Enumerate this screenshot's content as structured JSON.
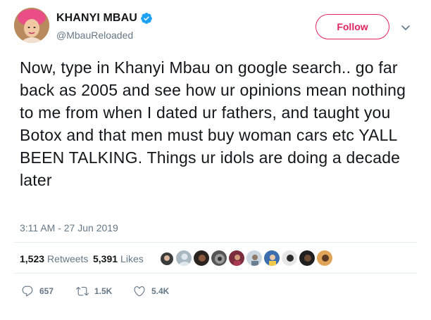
{
  "author": {
    "display_name": "KHANYI MBAU",
    "handle": "@MbauReloaded",
    "verified": true
  },
  "header": {
    "follow_label": "Follow"
  },
  "tweet": {
    "text": "Now, type in Khanyi Mbau on google search.. go far back as 2005 and see how ur opinions mean nothing to me from when I dated ur fathers, and taught you Botox and that men must buy woman cars etc YALL BEEN TALKING. Things ur idols are doing a decade later",
    "timestamp": "3:11 AM - 27 Jun 2019"
  },
  "stats": {
    "retweets_count": "1,523",
    "retweets_label": "Retweets",
    "likes_count": "5,391",
    "likes_label": "Likes"
  },
  "actions": {
    "reply_count": "657",
    "retweet_count": "1.5K",
    "like_count": "5.4K"
  },
  "colors": {
    "follow_accent": "#e0245e",
    "verified_blue": "#1da1f2",
    "secondary_text": "#657786"
  },
  "icons": [
    "verified-badge-icon",
    "chevron-down-icon",
    "reply-icon",
    "retweet-icon",
    "heart-icon"
  ]
}
